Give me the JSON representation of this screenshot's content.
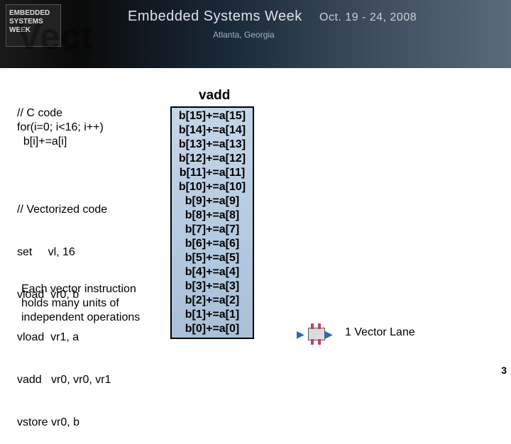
{
  "banner": {
    "logo_text": "EMBEDDED\nSYSTEMS\nWEEK",
    "title": "Embedded Systems Week",
    "dates": "Oct. 19 - 24, 2008",
    "location": "Atlanta, Georgia"
  },
  "slide_title_fragment": "Vect",
  "c_code": {
    "comment": "// C code",
    "line1": "for(i=0; i<16; i++)",
    "line2": "  b[i]+=a[i]"
  },
  "vect_code": {
    "comment": "// Vectorized code",
    "l1": "set     vl, 16",
    "l2": "vload  vr0, b",
    "l3": "vload  vr1, a",
    "l4": "vadd   vr0, vr0, vr1",
    "l5": "vstore vr0, b"
  },
  "note": "Each vector instruction holds many units of independent operations",
  "vadd": {
    "label": "vadd",
    "rows": [
      "b[15]+=a[15]",
      "b[14]+=a[14]",
      "b[13]+=a[13]",
      "b[12]+=a[12]",
      "b[11]+=a[11]",
      "b[10]+=a[10]",
      "b[9]+=a[9]",
      "b[8]+=a[8]",
      "b[7]+=a[7]",
      "b[6]+=a[6]",
      "b[5]+=a[5]",
      "b[4]+=a[4]",
      "b[3]+=a[3]",
      "b[2]+=a[2]",
      "b[1]+=a[1]",
      "b[0]+=a[0]"
    ]
  },
  "lane_label": "1 Vector Lane",
  "page_number": "3"
}
